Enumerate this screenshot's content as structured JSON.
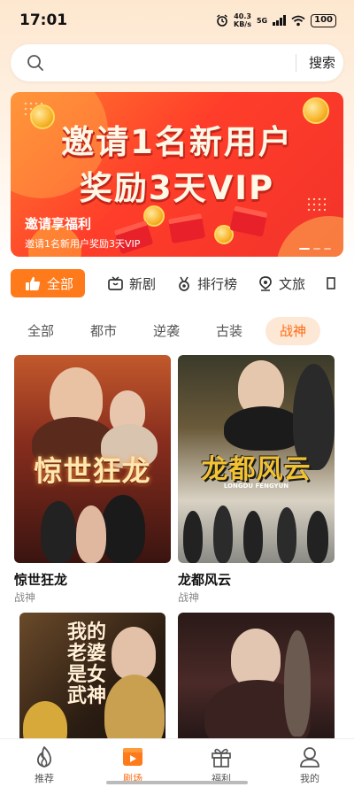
{
  "status_bar": {
    "time": "17:01",
    "speed_value": "40.3",
    "speed_unit": "KB/s",
    "network": "5G",
    "battery": "100"
  },
  "search": {
    "placeholder": "",
    "button_label": "搜索"
  },
  "banner": {
    "title_line1": "邀请1名新用户",
    "title_line2": "奖励3天VIP",
    "subtitle": "邀请享福利",
    "description": "邀请1名新用户奖励3天VIP"
  },
  "category_tabs": [
    {
      "label": "全部",
      "icon": "thumbs-up-icon",
      "active": true
    },
    {
      "label": "新剧",
      "icon": "tv-icon",
      "active": false
    },
    {
      "label": "排行榜",
      "icon": "medal-icon",
      "active": false
    },
    {
      "label": "文旅",
      "icon": "location-icon",
      "active": false
    }
  ],
  "genre_chips": [
    {
      "label": "全部",
      "active": false
    },
    {
      "label": "都市",
      "active": false
    },
    {
      "label": "逆袭",
      "active": false
    },
    {
      "label": "古装",
      "active": false
    },
    {
      "label": "战神",
      "active": true
    }
  ],
  "dramas": [
    {
      "title": "惊世狂龙",
      "tag": "战神",
      "poster_text": "惊世狂龙"
    },
    {
      "title": "龙都风云",
      "tag": "战神",
      "poster_text": "龙都风云",
      "poster_subtext": "LONGDU FENGYUN"
    },
    {
      "title": "",
      "tag": "",
      "poster_text": "我的老婆是女武神"
    },
    {
      "title": "",
      "tag": "",
      "poster_text": ""
    }
  ],
  "bottom_nav": [
    {
      "label": "推荐",
      "icon": "flame-icon",
      "active": false
    },
    {
      "label": "剧场",
      "icon": "theater-icon",
      "active": true
    },
    {
      "label": "福利",
      "icon": "gift-icon",
      "active": false
    },
    {
      "label": "我的",
      "icon": "profile-icon",
      "active": false
    }
  ],
  "colors": {
    "accent": "#ff7a1a",
    "accent_text": "#ff6a13",
    "chip_active_bg": "#fde8d6",
    "banner_red": "#f2332a"
  }
}
